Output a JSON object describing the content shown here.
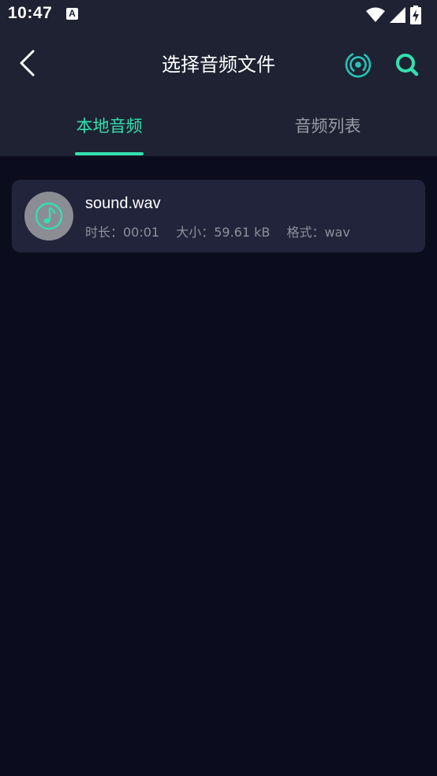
{
  "status_bar": {
    "time": "10:47",
    "notification_icon": "A"
  },
  "header": {
    "title": "选择音频文件",
    "back_icon": "chevron-left-icon",
    "radar_icon": "radar-scan-icon",
    "search_icon": "search-icon"
  },
  "tabs": [
    {
      "label": "本地音频",
      "active": true
    },
    {
      "label": "音频列表",
      "active": false
    }
  ],
  "files": [
    {
      "name": "sound.wav",
      "duration": "时长：00:01",
      "size": "大小：59.61 kB",
      "format": "格式：wav",
      "icon": "music-note-icon"
    }
  ],
  "colors": {
    "accent": "#33e0b0",
    "header_bg": "#1e2232",
    "page_bg": "#0b0d1e",
    "card_bg": "#21243a",
    "muted_text": "#8e909c"
  }
}
